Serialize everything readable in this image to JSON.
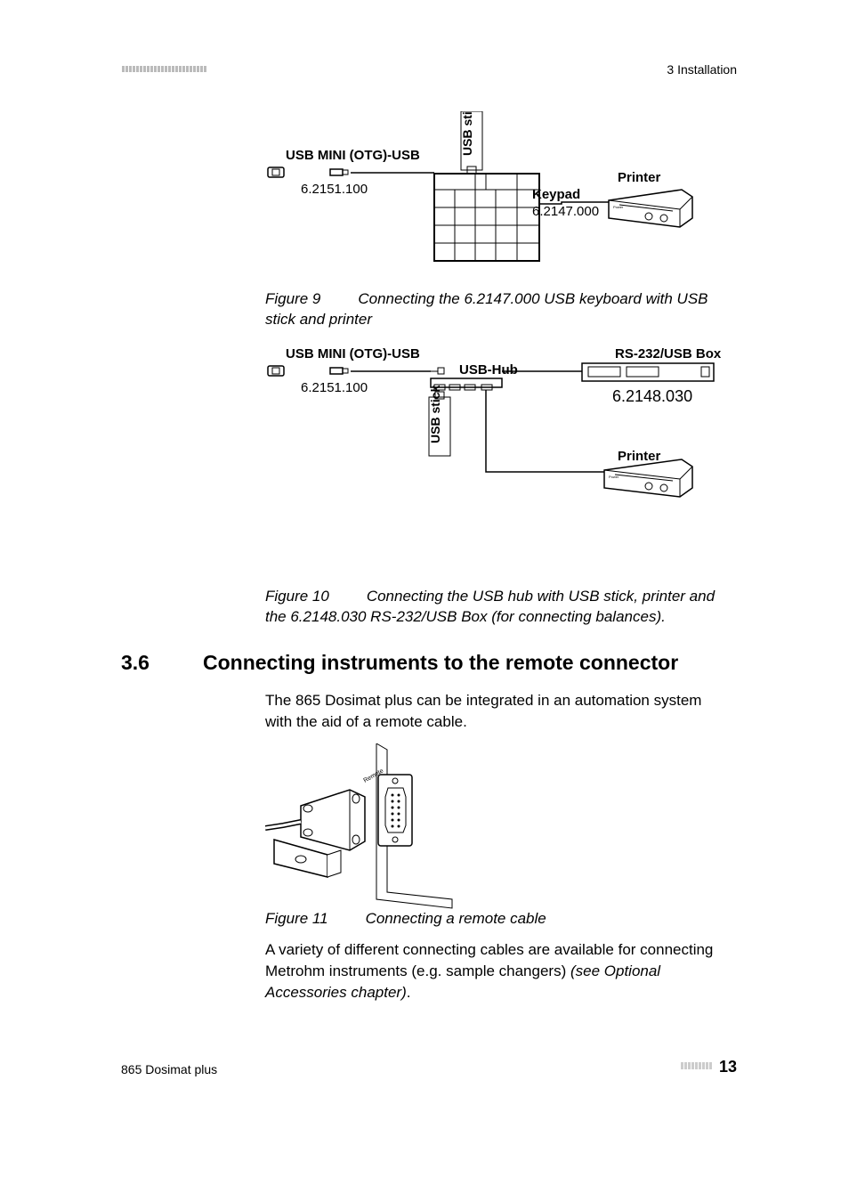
{
  "header": {
    "breadcrumb": "3 Installation"
  },
  "figures": {
    "fig9": {
      "labels": {
        "usb_mini": "USB MINI (OTG)-USB",
        "usb_mini_num": "6.2151.100",
        "usb_stick": "USB stick",
        "keypad": "Keypad",
        "keypad_num": "6.2147.000",
        "printer": "Printer"
      },
      "caption_label": "Figure 9",
      "caption_text": "Connecting the 6.2147.000 USB keyboard with USB stick and printer"
    },
    "fig10": {
      "labels": {
        "usb_mini": "USB MINI (OTG)-USB",
        "usb_mini_num": "6.2151.100",
        "usb_stick": "USB stick",
        "usb_hub": "USB-Hub",
        "rsbox": "RS-232/USB Box",
        "rsbox_num": "6.2148.030",
        "printer": "Printer"
      },
      "caption_label": "Figure 10",
      "caption_text": "Connecting the USB hub with USB stick, printer and the 6.2148.030 RS-232/USB Box (for connecting balances)."
    },
    "fig11": {
      "caption_label": "Figure 11",
      "caption_text": "Connecting a remote cable"
    }
  },
  "section": {
    "number": "3.6",
    "title": "Connecting instruments to the remote connector",
    "para1": "The 865 Dosimat plus can be integrated in an automation system with the aid of a remote cable.",
    "para2_plain": "A variety of different connecting cables are available for connecting Metrohm instruments (e.g. sample changers) ",
    "para2_italic": "(see Optional Accessories chapter)",
    "para2_end": "."
  },
  "footer": {
    "product": "865 Dosimat plus",
    "page": "13"
  }
}
